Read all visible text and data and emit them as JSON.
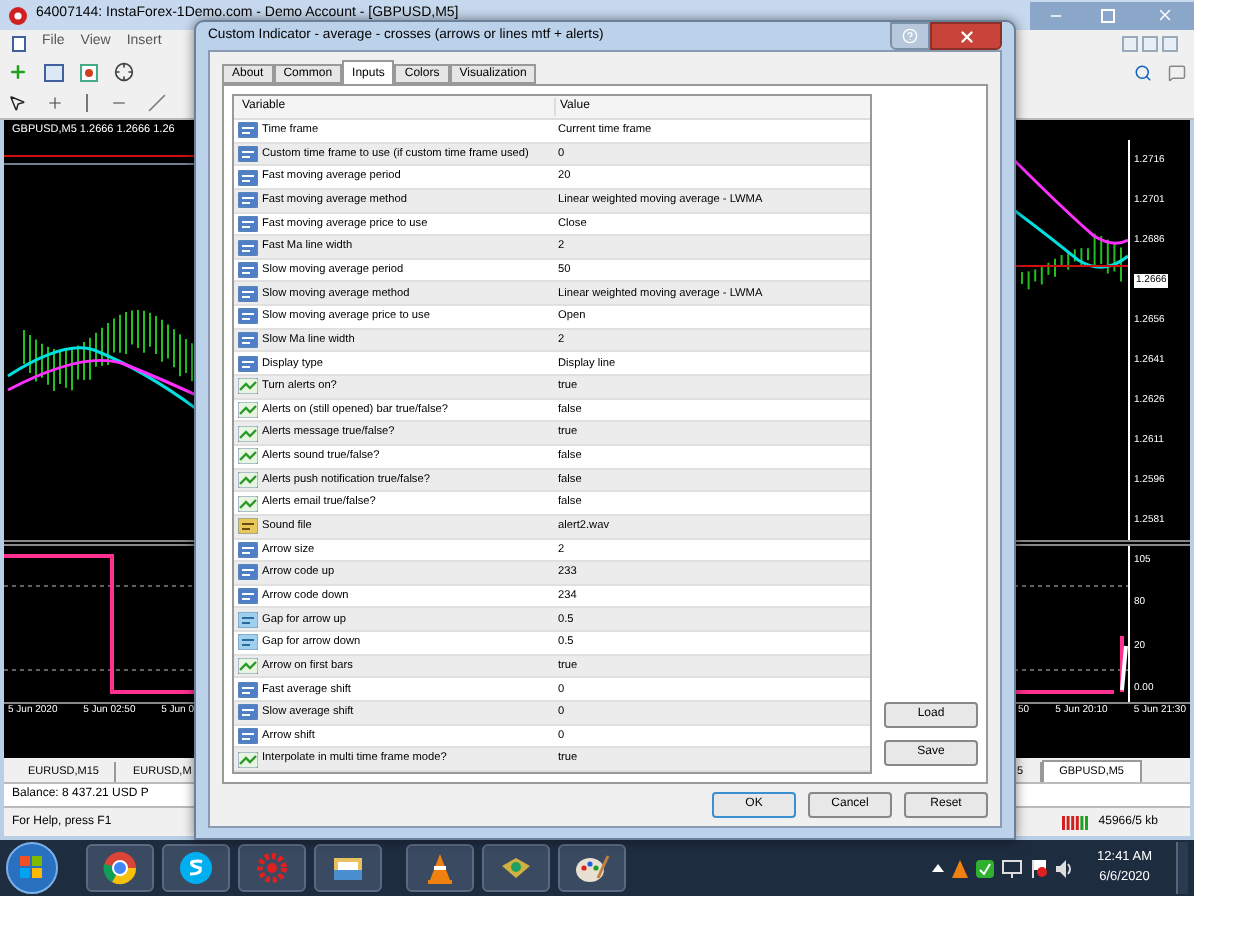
{
  "app": {
    "title": "64007144: InstaForex-1Demo.com - Demo Account - [GBPUSD,M5]",
    "menu": [
      "File",
      "View",
      "Insert"
    ],
    "left_chart": {
      "title": "GBPUSD,M5  1.2666 1.2666 1.26",
      "time_labels": [
        "5 Jun 2020",
        "5 Jun 02:50",
        "5 Jun 0"
      ]
    },
    "right_chart": {
      "price_labels": [
        "1.2716",
        "1.2701",
        "1.2686",
        "1.2666",
        "1.2656",
        "1.2641",
        "1.2626",
        "1.2611",
        "1.2596",
        "1.2581"
      ],
      "indicator_levels": [
        "105",
        "80",
        "20",
        "0.00"
      ],
      "time_labels": [
        "50",
        "5 Jun 20:10",
        "5 Jun 21:30"
      ]
    },
    "chart_tabs": [
      {
        "label": "EURUSD,M15",
        "selected": false
      },
      {
        "label": "EURUSD,M",
        "selected": false
      },
      {
        "label": "5",
        "selected": false
      },
      {
        "label": "GBPUSD,M5",
        "selected": true
      }
    ],
    "terminal": {
      "balance": "Balance: 8 437.21 USD  P"
    },
    "status_bar": {
      "help": "For Help, press F1",
      "traffic": "45966/5 kb"
    }
  },
  "dialog": {
    "title": "Custom Indicator - average - crosses (arrows or lines mtf + alerts)",
    "tabs": [
      {
        "label": "About",
        "selected": false
      },
      {
        "label": "Common",
        "selected": false
      },
      {
        "label": "Inputs",
        "selected": true
      },
      {
        "label": "Colors",
        "selected": false
      },
      {
        "label": "Visualization",
        "selected": false
      }
    ],
    "columns": [
      "Variable",
      "Value"
    ],
    "rows": [
      {
        "kind": "int",
        "variable": "Time frame",
        "value": "Current time frame"
      },
      {
        "kind": "int",
        "variable": "Custom time frame to use (if custom time frame used)",
        "value": "0"
      },
      {
        "kind": "int",
        "variable": "Fast moving average period",
        "value": "20"
      },
      {
        "kind": "int",
        "variable": "Fast moving average method",
        "value": "Linear weighted moving average - LWMA"
      },
      {
        "kind": "int",
        "variable": "Fast moving average price to use",
        "value": "Close"
      },
      {
        "kind": "int",
        "variable": "Fast Ma line width",
        "value": "2"
      },
      {
        "kind": "int",
        "variable": "Slow moving average period",
        "value": "50"
      },
      {
        "kind": "int",
        "variable": "Slow moving average method",
        "value": "Linear weighted moving average - LWMA"
      },
      {
        "kind": "int",
        "variable": "Slow moving average price to use",
        "value": "Open"
      },
      {
        "kind": "int",
        "variable": "Slow Ma line width",
        "value": "2"
      },
      {
        "kind": "int",
        "variable": "Display type",
        "value": "Display line"
      },
      {
        "kind": "bool",
        "variable": "Turn alerts on?",
        "value": "true"
      },
      {
        "kind": "bool",
        "variable": "Alerts on (still opened) bar true/false?",
        "value": "false"
      },
      {
        "kind": "bool",
        "variable": "Alerts message true/false?",
        "value": "true"
      },
      {
        "kind": "bool",
        "variable": "Alerts sound true/false?",
        "value": "false"
      },
      {
        "kind": "bool",
        "variable": "Alerts push notification true/false?",
        "value": "false"
      },
      {
        "kind": "bool",
        "variable": "Alerts email true/false?",
        "value": "false"
      },
      {
        "kind": "string",
        "variable": "Sound file",
        "value": "alert2.wav"
      },
      {
        "kind": "int",
        "variable": "Arrow size",
        "value": "2"
      },
      {
        "kind": "int",
        "variable": "Arrow code up",
        "value": "233"
      },
      {
        "kind": "int",
        "variable": "Arrow code down",
        "value": "234"
      },
      {
        "kind": "double",
        "variable": "Gap for arrow up",
        "value": "0.5"
      },
      {
        "kind": "double",
        "variable": "Gap for arrow down",
        "value": "0.5"
      },
      {
        "kind": "bool",
        "variable": "Arrow on first bars",
        "value": "true"
      },
      {
        "kind": "int",
        "variable": "Fast average shift",
        "value": "0"
      },
      {
        "kind": "int",
        "variable": "Slow average shift",
        "value": "0"
      },
      {
        "kind": "int",
        "variable": "Arrow shift",
        "value": "0"
      },
      {
        "kind": "bool",
        "variable": "Interpolate in multi time frame mode?",
        "value": "true"
      }
    ],
    "side_buttons": [
      "Load",
      "Save"
    ],
    "buttons": [
      "OK",
      "Cancel",
      "Reset"
    ]
  },
  "taskbar": {
    "time": "12:41 AM",
    "date": "6/6/2020"
  }
}
